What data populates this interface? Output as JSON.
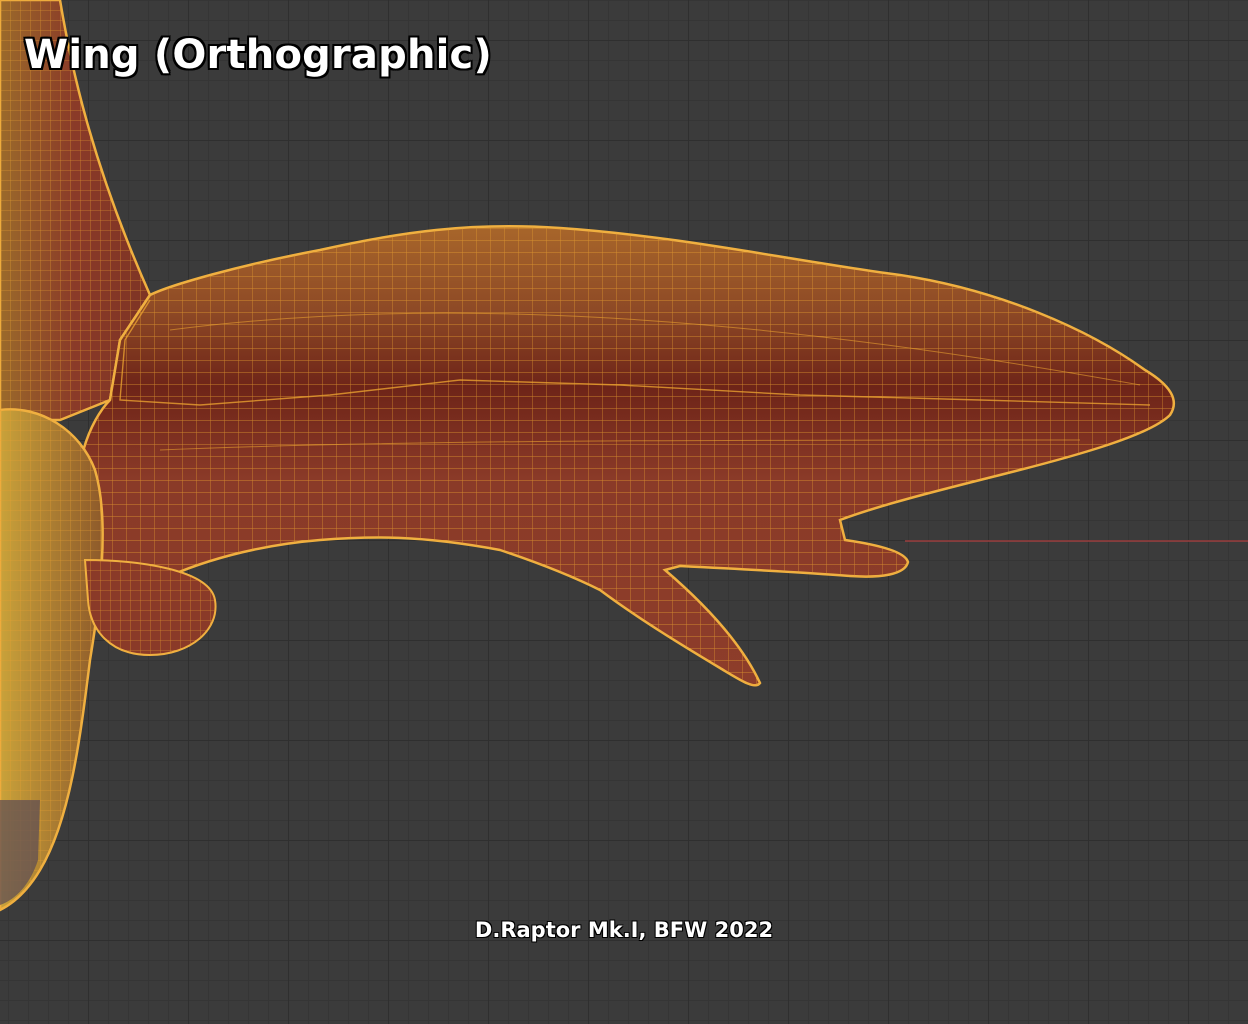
{
  "viewport": {
    "title": "Wing (Orthographic)",
    "credit": "D.Raptor Mk.I, BFW 2022",
    "projection": "orthographic",
    "colors": {
      "background": "#3b3b3b",
      "grid": "#2f2f2f",
      "mesh_fill": "#8a3a28",
      "mesh_dark": "#6e2418",
      "wireframe": "#e8a030",
      "wireframe_selected": "#f0b040",
      "axis_x": "#c84040"
    },
    "object": {
      "name_icon": "wing-mesh",
      "display": "wireframe-overlay",
      "selected": true
    }
  }
}
